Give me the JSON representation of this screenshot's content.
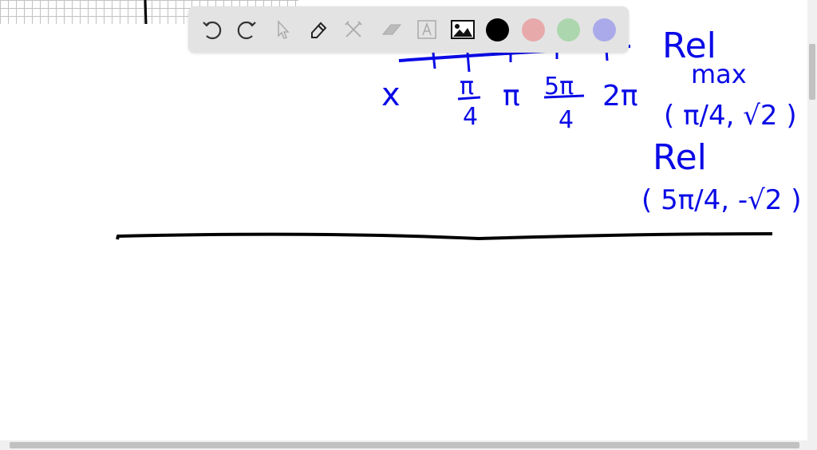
{
  "toolbar": {
    "tools": [
      "undo-icon",
      "redo-icon",
      "select-icon",
      "pen-icon",
      "tools-icon",
      "eraser-icon",
      "text-icon",
      "image-icon"
    ],
    "colors": {
      "black": "#000000",
      "red": "#e8a9ab",
      "green": "#acd6ad",
      "blue": "#aaaaea"
    }
  },
  "ink_color": "#0a0ae6",
  "board": {
    "axis_labels": [
      "x",
      "π/4",
      "π",
      "5π/4",
      "2π"
    ],
    "x_label": "x",
    "pi4_num": "π",
    "pi4_den": "4",
    "pi": "π",
    "fivepi4_num": "5π",
    "fivepi4_den": "4",
    "twopi": "2π",
    "rel1": "Rel",
    "max": "max",
    "point1": "( π/4, √2 )",
    "rel2": "Rel",
    "point2": "( 5π/4, -√2 )"
  }
}
